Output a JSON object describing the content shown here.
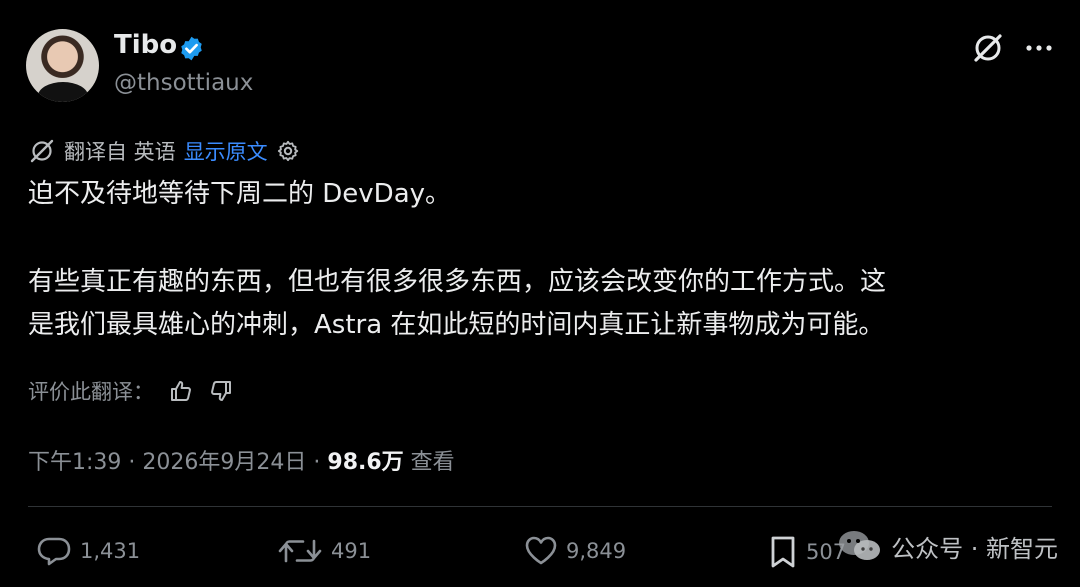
{
  "author": {
    "name": "Tibo",
    "handle": "@thsottiaux"
  },
  "translation": {
    "label": "翻译自 英语",
    "show_original": "显示原文"
  },
  "tweet": {
    "line1": "迫不及待地等待下周二的 DevDay。",
    "line2": "有些真正有趣的东西，但也有很多很多东西，应该会改变你的工作方式。这",
    "line3": "是我们最具雄心的冲刺，Astra 在如此短的时间内真正让新事物成为可能。"
  },
  "rating": {
    "label": "评价此翻译："
  },
  "meta": {
    "time": "下午1:39",
    "date": "2026年9月24日",
    "separator": "·",
    "views": "98.6万",
    "views_label": "查看"
  },
  "actions": {
    "replies": "1,431",
    "retweets": "491",
    "likes": "9,849",
    "bookmarks": "507"
  },
  "watermark": {
    "text": "公众号 · 新智元"
  },
  "colors": {
    "background": "#000000",
    "link": "#3b8cff",
    "verified": "#1d9bf0",
    "muted": "#8b9096"
  }
}
